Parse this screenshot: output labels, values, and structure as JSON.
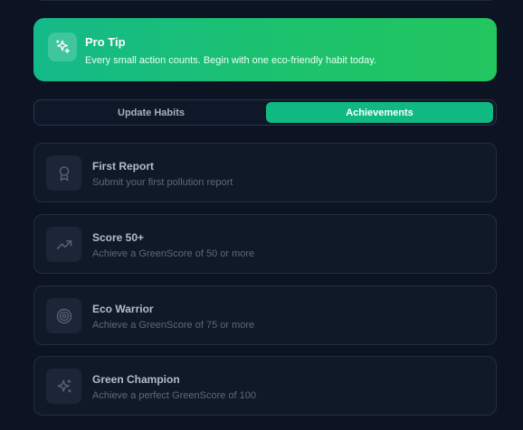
{
  "pro_tip": {
    "title": "Pro Tip",
    "description": "Every small action counts. Begin with one eco-friendly habit today.",
    "icon": "sparkles-icon"
  },
  "tabs": [
    {
      "label": "Update Habits",
      "active": false
    },
    {
      "label": "Achievements",
      "active": true
    }
  ],
  "achievements": [
    {
      "title": "First Report",
      "description": "Submit your first pollution report",
      "icon": "award-icon"
    },
    {
      "title": "Score 50+",
      "description": "Achieve a GreenScore of 50 or more",
      "icon": "trending-up-icon"
    },
    {
      "title": "Eco Warrior",
      "description": "Achieve a GreenScore of 75 or more",
      "icon": "target-icon"
    },
    {
      "title": "Green Champion",
      "description": "Achieve a perfect GreenScore of 100",
      "icon": "sparkles-icon"
    }
  ],
  "colors": {
    "accent": "#10b981",
    "background": "#0c1424",
    "card": "#101928"
  }
}
